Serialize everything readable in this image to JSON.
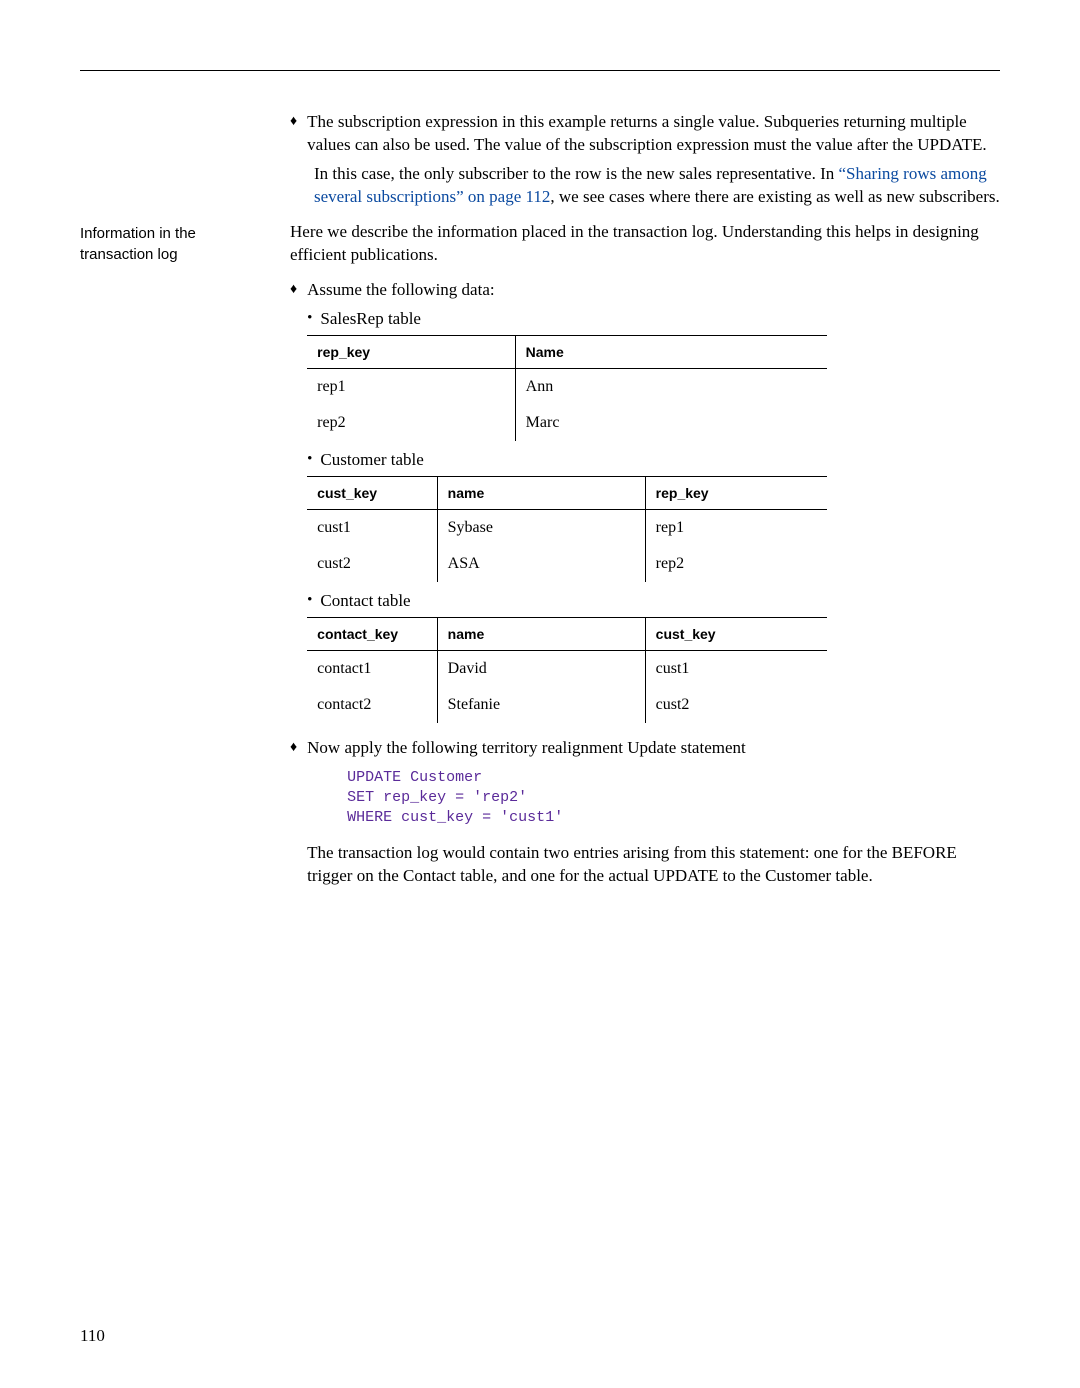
{
  "side_label": "Information in the transaction log",
  "page_number": "110",
  "para1": "The subscription expression in this example returns a single value. Subqueries returning multiple values can also be used. The value of the subscription expression must the value after the UPDATE.",
  "para2_pre": "In this case, the only subscriber to the row is the new sales representative. In ",
  "para2_link": "“Sharing rows among several subscriptions” on page 112",
  "para2_post": ", we see cases where there are existing as well as new subscribers.",
  "para3": "Here we describe the information placed in the transaction log. Understanding this helps in designing efficient publications.",
  "assume_label": "Assume the following data:",
  "salesrep_label": "SalesRep table",
  "customer_label": "Customer table",
  "contact_label": "Contact table",
  "salesrep": {
    "h0": "rep_key",
    "h1": "Name",
    "r0c0": "rep1",
    "r0c1": "Ann",
    "r1c0": "rep2",
    "r1c1": "Marc"
  },
  "customer": {
    "h0": "cust_key",
    "h1": "name",
    "h2": "rep_key",
    "r0c0": "cust1",
    "r0c1": "Sybase",
    "r0c2": "rep1",
    "r1c0": "cust2",
    "r1c1": "ASA",
    "r1c2": "rep2"
  },
  "contact": {
    "h0": "contact_key",
    "h1": "name",
    "h2": "cust_key",
    "r0c0": "contact1",
    "r0c1": "David",
    "r0c2": "cust1",
    "r1c0": "contact2",
    "r1c1": "Stefanie",
    "r1c2": "cust2"
  },
  "apply_label": "Now apply the following territory realignment Update statement",
  "code": "UPDATE Customer\nSET rep_key = 'rep2'\nWHERE cust_key = 'cust1'",
  "para_after_code": "The transaction log would contain two entries arising from this statement: one for the BEFORE trigger on the Contact table, and one for the actual UPDATE to the Customer table."
}
